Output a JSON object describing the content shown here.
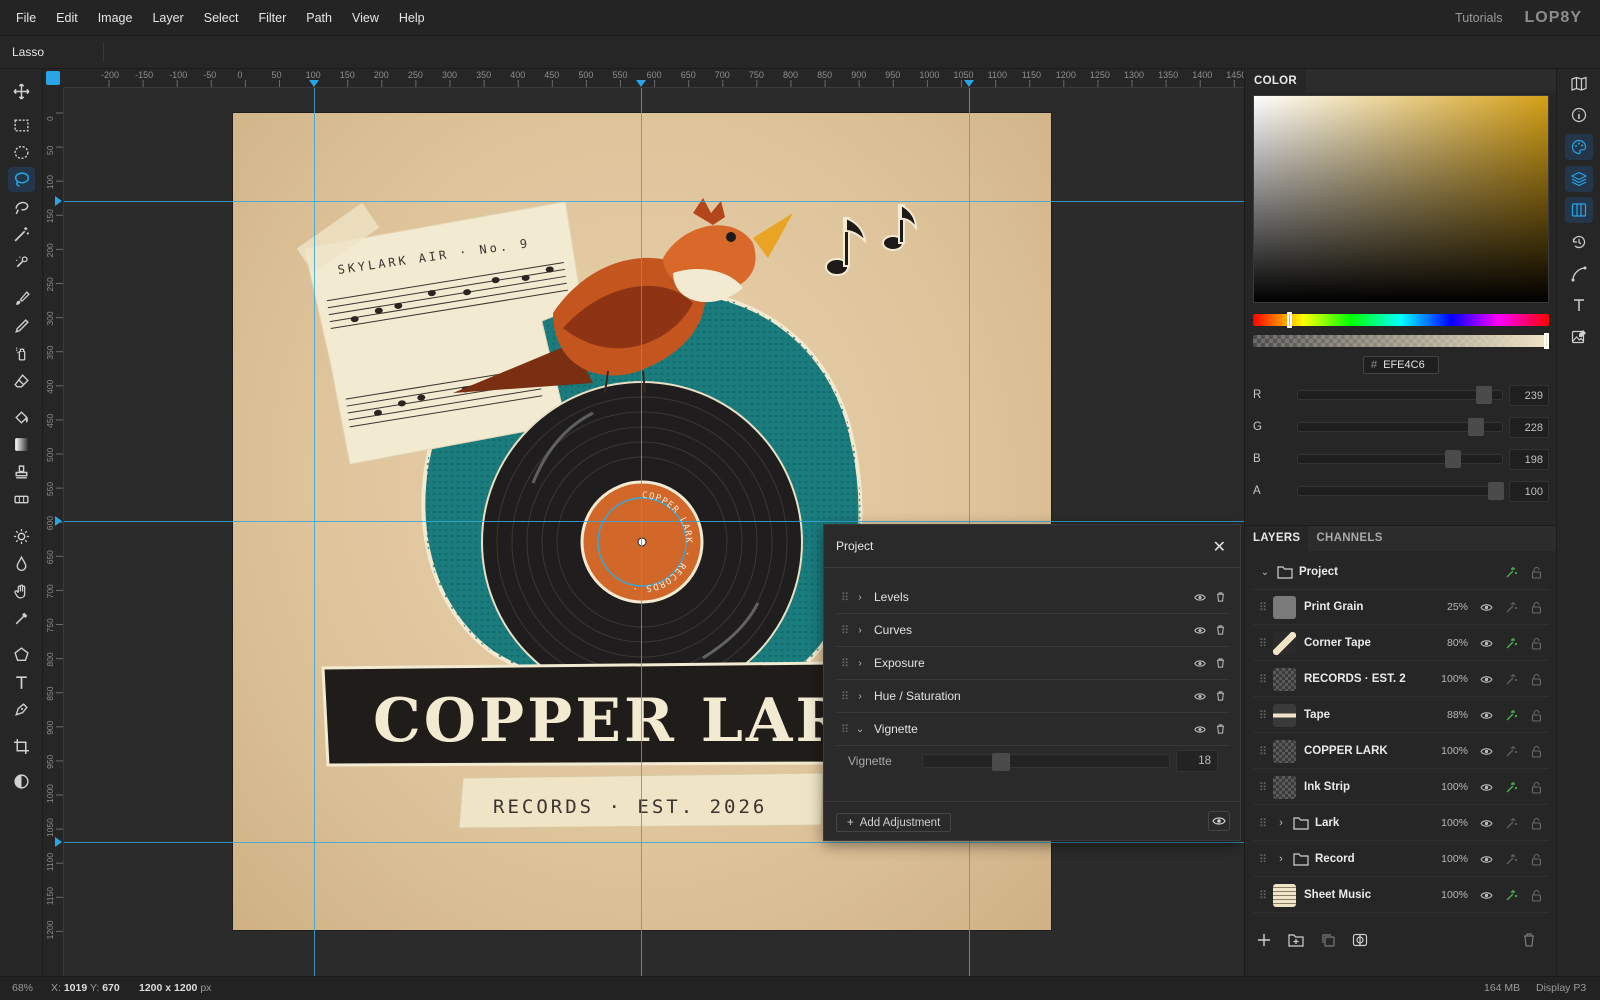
{
  "menu": [
    "File",
    "Edit",
    "Image",
    "Layer",
    "Select",
    "Filter",
    "Path",
    "View",
    "Help"
  ],
  "header": {
    "tutorials": "Tutorials",
    "logo": "LOP8Y"
  },
  "options": {
    "tool_name": "Lasso"
  },
  "rulers": {
    "top": [
      "-200",
      "-150",
      "-100",
      "-50",
      "0",
      "50",
      "100",
      "150",
      "200",
      "250",
      "300",
      "350",
      "400",
      "450",
      "500",
      "550",
      "600",
      "650",
      "700",
      "750",
      "800",
      "850",
      "900",
      "950",
      "1000",
      "1050",
      "1100",
      "1150",
      "1200",
      "1250",
      "1300",
      "1350",
      "1400",
      "1450"
    ],
    "left": [
      "0",
      "50",
      "100",
      "150",
      "200",
      "250",
      "300",
      "350",
      "400",
      "450",
      "500",
      "550",
      "600",
      "650",
      "700",
      "750",
      "800",
      "850",
      "900",
      "950",
      "1000",
      "1050",
      "1100",
      "1150",
      "1200"
    ]
  },
  "artwork": {
    "sheet_text": "SKYLARK AIR · No. 9",
    "banner_text": "COPPER LARK",
    "tape_text": "RECORDS · EST. 2026",
    "label_text": "COPPER LARK · RECORDS ·"
  },
  "project_panel": {
    "title": "Project",
    "close": "✕",
    "adjustments": [
      {
        "label": "Levels",
        "expanded": false
      },
      {
        "label": "Curves",
        "expanded": false
      },
      {
        "label": "Exposure",
        "expanded": false
      },
      {
        "label": "Hue / Saturation",
        "expanded": false
      },
      {
        "label": "Vignette",
        "expanded": true
      }
    ],
    "vignette": {
      "label": "Vignette",
      "value": "18",
      "fraction": 0.18
    },
    "add_adjustment": "Add Adjustment"
  },
  "color_panel": {
    "tab": "COLOR",
    "hex_prefix": "#",
    "hex": "EFE4C6",
    "hue_fraction": 0.12,
    "channels": [
      {
        "label": "R",
        "value": "239",
        "fraction": 0.937
      },
      {
        "label": "G",
        "value": "228",
        "fraction": 0.894
      },
      {
        "label": "B",
        "value": "198",
        "fraction": 0.776
      },
      {
        "label": "A",
        "value": "100",
        "fraction": 1.0
      }
    ]
  },
  "layers_panel": {
    "tabs": [
      "LAYERS",
      "CHANNELS"
    ],
    "group": {
      "name": "Project"
    },
    "layers": [
      {
        "name": "Print Grain",
        "opacity": "25%",
        "thumb": "grain",
        "fx": false
      },
      {
        "name": "Corner Tape",
        "opacity": "80%",
        "thumb": "tape",
        "fx": true
      },
      {
        "name": "RECORDS · EST. 2",
        "opacity": "100%",
        "thumb": "checker",
        "fx": false
      },
      {
        "name": "Tape",
        "opacity": "88%",
        "thumb": "tapeline",
        "fx": true
      },
      {
        "name": "COPPER LARK",
        "opacity": "100%",
        "thumb": "checker",
        "fx": false
      },
      {
        "name": "Ink Strip",
        "opacity": "100%",
        "thumb": "checker",
        "fx": true
      },
      {
        "name": "Lark",
        "opacity": "100%",
        "thumb": "folder",
        "fx": false
      },
      {
        "name": "Record",
        "opacity": "100%",
        "thumb": "folder",
        "fx": false
      },
      {
        "name": "Sheet Music",
        "opacity": "100%",
        "thumb": "sheet",
        "fx": true
      }
    ]
  },
  "status": {
    "zoom": "68%",
    "coords_x_label": "X:",
    "coords_x": "1019",
    "coords_y_label": "Y:",
    "coords_y": "670",
    "doc_size": "1200 x 1200",
    "doc_unit": "px",
    "memory": "164 MB",
    "profile": "Display P3"
  },
  "colors": {
    "accent": "#2aa4e8",
    "guide": "#35a7d8",
    "fx_active": "#4caf50",
    "teal": "#197a7a",
    "copper": "#d2672a"
  }
}
